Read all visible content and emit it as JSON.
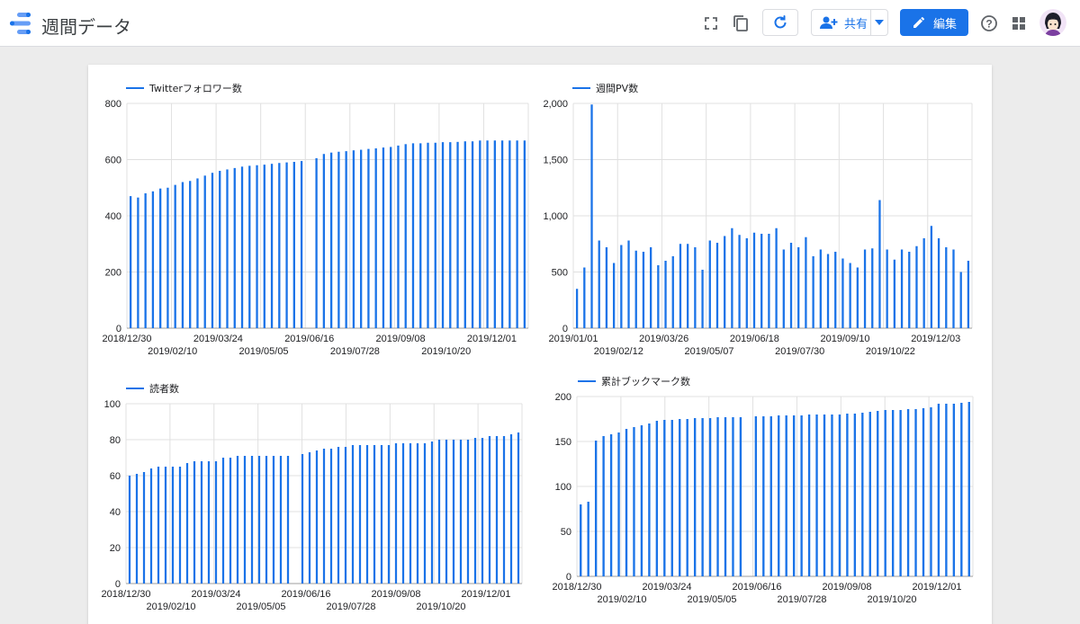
{
  "header": {
    "title": "週間データ",
    "share_label": "共有",
    "edit_label": "編集"
  },
  "icons": [
    "data-studio-logo",
    "fullscreen-icon",
    "copy-icon",
    "refresh-icon",
    "add-person-icon",
    "caret-down-icon",
    "pencil-icon",
    "help-icon",
    "apps-grid-icon",
    "avatar"
  ],
  "colors": {
    "accent": "#1a73e8",
    "series": "#1a73e8"
  },
  "chart_data": [
    {
      "type": "bar",
      "legend": "Twitterフォロワー数",
      "yticks": [
        "800",
        "600",
        "400",
        "200",
        "0"
      ],
      "xticks_row1": [
        "2018/12/30",
        "2019/03/24",
        "2019/06/16",
        "2019/09/08",
        "2019/12/01"
      ],
      "xticks_row2": [
        "2019/02/10",
        "2019/05/05",
        "2019/07/28",
        "2019/10/20"
      ],
      "ylim": [
        0,
        800
      ],
      "values": [
        470,
        465,
        480,
        487,
        497,
        500,
        510,
        520,
        524,
        533,
        543,
        553,
        560,
        565,
        570,
        575,
        578,
        580,
        582,
        585,
        588,
        590,
        592,
        595,
        0,
        605,
        620,
        625,
        628,
        630,
        633,
        635,
        638,
        640,
        643,
        645,
        650,
        655,
        658,
        658,
        660,
        660,
        662,
        662,
        663,
        665,
        665,
        668,
        668,
        668,
        668,
        668,
        668,
        668
      ]
    },
    {
      "type": "bar",
      "legend": "週間PV数",
      "yticks": [
        "2,000",
        "1,500",
        "1,000",
        "500",
        "0"
      ],
      "xticks_row1": [
        "2019/01/01",
        "2019/03/26",
        "2019/06/18",
        "2019/09/10",
        "2019/12/03"
      ],
      "xticks_row2": [
        "2019/02/12",
        "2019/05/07",
        "2019/07/30",
        "2019/10/22"
      ],
      "ylim": [
        0,
        2000
      ],
      "values": [
        350,
        540,
        1990,
        780,
        720,
        580,
        740,
        780,
        690,
        680,
        720,
        560,
        600,
        640,
        750,
        750,
        720,
        520,
        780,
        760,
        820,
        890,
        830,
        800,
        850,
        840,
        840,
        890,
        700,
        760,
        720,
        810,
        640,
        700,
        660,
        680,
        620,
        580,
        540,
        700,
        710,
        1140,
        700,
        610,
        700,
        680,
        730,
        800,
        910,
        800,
        720,
        700,
        500,
        600
      ]
    },
    {
      "type": "bar",
      "legend": "読者数",
      "yticks": [
        "100",
        "80",
        "60",
        "40",
        "20",
        "0"
      ],
      "xticks_row1": [
        "2018/12/30",
        "2019/03/24",
        "2019/06/16",
        "2019/09/08",
        "2019/12/01"
      ],
      "xticks_row2": [
        "2019/02/10",
        "2019/05/05",
        "2019/07/28",
        "2019/10/20"
      ],
      "ylim": [
        0,
        100
      ],
      "values": [
        60,
        61,
        62,
        64,
        65,
        65,
        65,
        65,
        67,
        68,
        68,
        68,
        68,
        70,
        70,
        71,
        71,
        71,
        71,
        71,
        71,
        71,
        71,
        0,
        72,
        73,
        74,
        75,
        75,
        76,
        76,
        77,
        77,
        77,
        77,
        77,
        77,
        78,
        78,
        78,
        78,
        78,
        79,
        80,
        80,
        80,
        80,
        80,
        81,
        81,
        82,
        82,
        82,
        83,
        84
      ]
    },
    {
      "type": "bar",
      "legend": "累計ブックマーク数",
      "yticks": [
        "200",
        "150",
        "100",
        "50",
        "0"
      ],
      "xticks_row1": [
        "2018/12/30",
        "2019/03/24",
        "2019/06/16",
        "2019/09/08",
        "2019/12/01"
      ],
      "xticks_row2": [
        "2019/02/10",
        "2019/05/05",
        "2019/07/28",
        "2019/10/20"
      ],
      "ylim": [
        0,
        200
      ],
      "values": [
        80,
        83,
        151,
        156,
        158,
        160,
        164,
        166,
        168,
        170,
        173,
        174,
        174,
        175,
        175,
        176,
        176,
        176,
        177,
        177,
        177,
        177,
        0,
        178,
        178,
        178,
        179,
        179,
        179,
        179,
        180,
        180,
        180,
        180,
        180,
        181,
        181,
        182,
        183,
        184,
        185,
        185,
        185,
        186,
        186,
        187,
        188,
        192,
        192,
        192,
        193,
        194
      ]
    }
  ]
}
